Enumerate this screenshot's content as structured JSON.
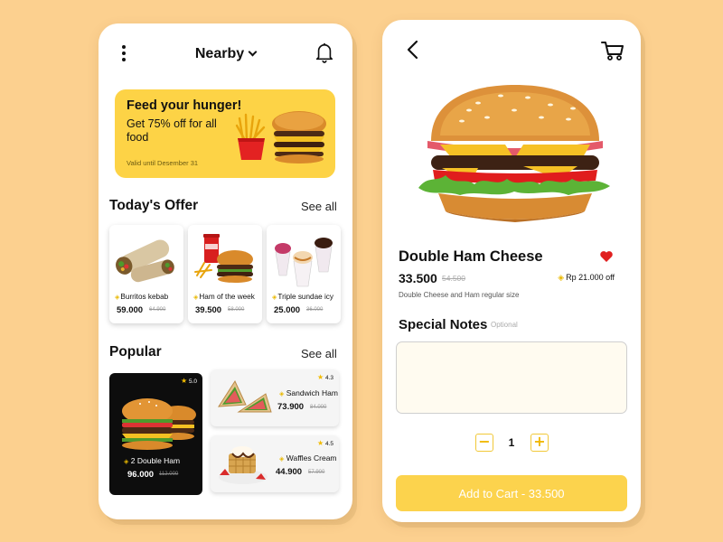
{
  "colors": {
    "background": "#fcd08f",
    "accent": "#fdd346",
    "favorite": "#e02020"
  },
  "home": {
    "header": {
      "location": "Nearby",
      "menu_icon": "kebab-menu-icon",
      "notification_icon": "bell-icon"
    },
    "banner": {
      "title": "Feed your hunger!",
      "subtitle": "Get 75% off for all food",
      "validity": "Valid until Desember 31"
    },
    "todays_offer": {
      "title": "Today's Offer",
      "see_all": "See all",
      "items": [
        {
          "name": "Burritos kebab",
          "price": "59.000",
          "old_price": "64.900"
        },
        {
          "name": "Ham of the week",
          "price": "39.500",
          "old_price": "58.000"
        },
        {
          "name": "Triple sundae icy",
          "price": "25.000",
          "old_price": "36.000"
        }
      ]
    },
    "popular": {
      "title": "Popular",
      "see_all": "See all",
      "items": [
        {
          "name": "2 Double Ham",
          "price": "96.000",
          "old_price": "112.000",
          "rating": "5.0"
        },
        {
          "name": "Sandwich Ham",
          "price": "73.900",
          "old_price": "84.000",
          "rating": "4.3"
        },
        {
          "name": "Waffles Cream",
          "price": "44.900",
          "old_price": "57.900",
          "rating": "4.5"
        }
      ]
    }
  },
  "detail": {
    "back_icon": "chevron-left-icon",
    "cart_icon": "cart-icon",
    "name": "Double Ham Cheese",
    "favorite": true,
    "price": "33.500",
    "old_price": "54.500",
    "discount": "Rp 21.000 off",
    "description": "Double Cheese and Ham regular size",
    "notes_title": "Special Notes",
    "notes_optional": "Optional",
    "notes_value": "",
    "quantity": "1",
    "minus_label": "−",
    "plus_label": "+",
    "add_to_cart": "Add to Cart - 33.500"
  }
}
